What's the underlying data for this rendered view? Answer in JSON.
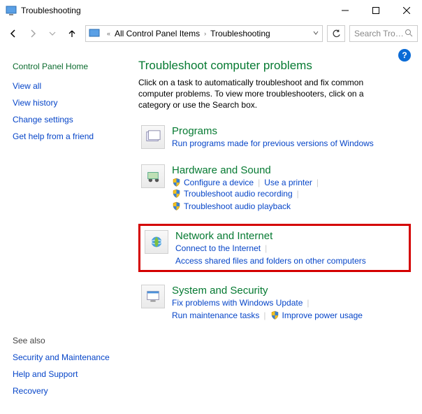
{
  "window": {
    "title": "Troubleshooting"
  },
  "breadcrumb": {
    "item1": "All Control Panel Items",
    "item2": "Troubleshooting"
  },
  "search": {
    "placeholder": "Search Tro…"
  },
  "sidebar": {
    "home": "Control Panel Home",
    "links": [
      "View all",
      "View history",
      "Change settings",
      "Get help from a friend"
    ]
  },
  "main": {
    "heading": "Troubleshoot computer problems",
    "desc": "Click on a task to automatically troubleshoot and fix common computer problems. To view more troubleshooters, click on a category or use the Search box."
  },
  "categories": [
    {
      "title": "Programs",
      "links": [
        {
          "label": "Run programs made for previous versions of Windows",
          "shield": false
        }
      ]
    },
    {
      "title": "Hardware and Sound",
      "links": [
        {
          "label": "Configure a device",
          "shield": true
        },
        {
          "label": "Use a printer",
          "shield": false
        },
        {
          "label": "Troubleshoot audio recording",
          "shield": true
        },
        {
          "label": "Troubleshoot audio playback",
          "shield": true
        }
      ]
    },
    {
      "title": "Network and Internet",
      "highlight": true,
      "links": [
        {
          "label": "Connect to the Internet",
          "shield": false
        },
        {
          "label": "Access shared files and folders on other computers",
          "shield": false
        }
      ]
    },
    {
      "title": "System and Security",
      "links": [
        {
          "label": "Fix problems with Windows Update",
          "shield": false
        },
        {
          "label": "Run maintenance tasks",
          "shield": false
        },
        {
          "label": "Improve power usage",
          "shield": true
        }
      ]
    }
  ],
  "seealso": {
    "header": "See also",
    "links": [
      "Security and Maintenance",
      "Help and Support",
      "Recovery"
    ]
  }
}
